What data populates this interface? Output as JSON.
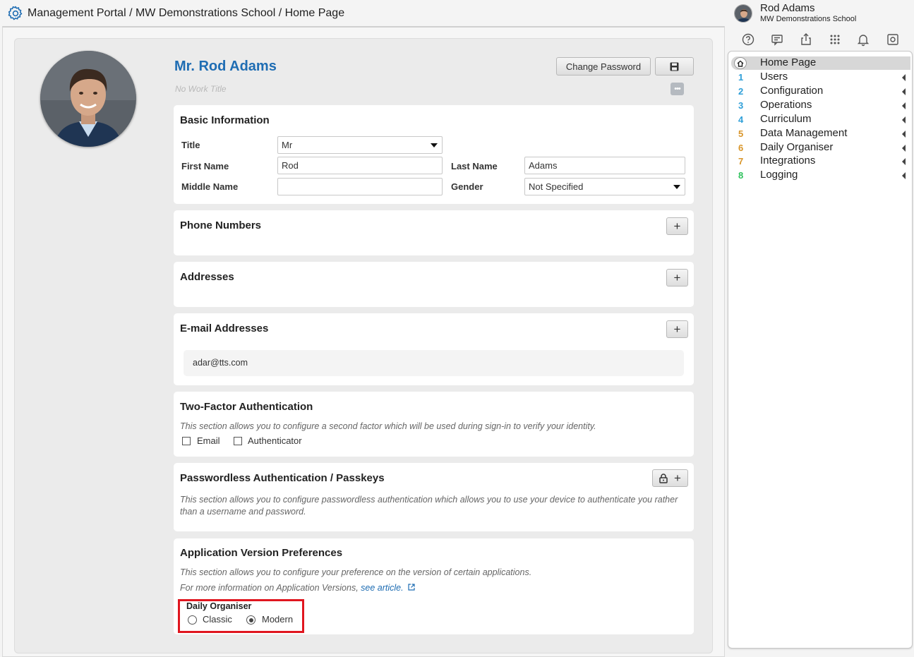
{
  "header": {
    "breadcrumb": "Management Portal / MW Demonstrations School / Home Page",
    "icon": "gear-icon"
  },
  "user": {
    "name": "Rod Adams",
    "school": "MW Demonstrations School"
  },
  "toolbar_icons": [
    "help-icon",
    "messages-icon",
    "share-icon",
    "apps-grid-icon",
    "bell-icon",
    "settings-icon"
  ],
  "profile": {
    "display_name": "Mr. Rod Adams",
    "work_title_placeholder": "No Work Title",
    "change_password_label": "Change Password",
    "more_label": "•••"
  },
  "basic_info": {
    "title": "Basic Information",
    "title_label": "Title",
    "title_value": "Mr",
    "first_name_label": "First Name",
    "first_name_value": "Rod",
    "last_name_label": "Last Name",
    "last_name_value": "Adams",
    "middle_name_label": "Middle Name",
    "middle_name_value": "",
    "gender_label": "Gender",
    "gender_value": "Not Specified"
  },
  "phones": {
    "title": "Phone Numbers",
    "add": "+"
  },
  "addresses": {
    "title": "Addresses",
    "add": "+"
  },
  "emails": {
    "title": "E-mail Addresses",
    "add": "+",
    "items": [
      "adar@tts.com"
    ]
  },
  "two_factor": {
    "title": "Two-Factor Authentication",
    "description": "This section allows you to configure a second factor which will be used during sign-in to verify your identity.",
    "options": [
      "Email",
      "Authenticator"
    ]
  },
  "passkeys": {
    "title": "Passwordless Authentication / Passkeys",
    "description": "This section allows you to configure passwordless authentication which allows you to use your device to authenticate you rather than a username and password.",
    "add": "+"
  },
  "app_versions": {
    "title": "Application Version Preferences",
    "description": "This section allows you to configure your preference on the version of certain applications.",
    "more_info": "For more information on Application Versions,",
    "link_text": "see article.",
    "group_label": "Daily Organiser",
    "options": [
      "Classic",
      "Modern"
    ],
    "selected": "Modern"
  },
  "nav": {
    "home": "Home Page",
    "items": [
      {
        "num": "1",
        "label": "Users",
        "color": "#2f9fd8"
      },
      {
        "num": "2",
        "label": "Configuration",
        "color": "#2f9fd8"
      },
      {
        "num": "3",
        "label": "Operations",
        "color": "#2f9fd8"
      },
      {
        "num": "4",
        "label": "Curriculum",
        "color": "#2f9fd8"
      },
      {
        "num": "5",
        "label": "Data Management",
        "color": "#d9962b"
      },
      {
        "num": "6",
        "label": "Daily Organiser",
        "color": "#d9962b"
      },
      {
        "num": "7",
        "label": "Integrations",
        "color": "#d9962b"
      },
      {
        "num": "8",
        "label": "Logging",
        "color": "#2ec25c"
      }
    ]
  },
  "colors": {
    "accent": "#1f6db3",
    "highlight": "#e0161f"
  }
}
